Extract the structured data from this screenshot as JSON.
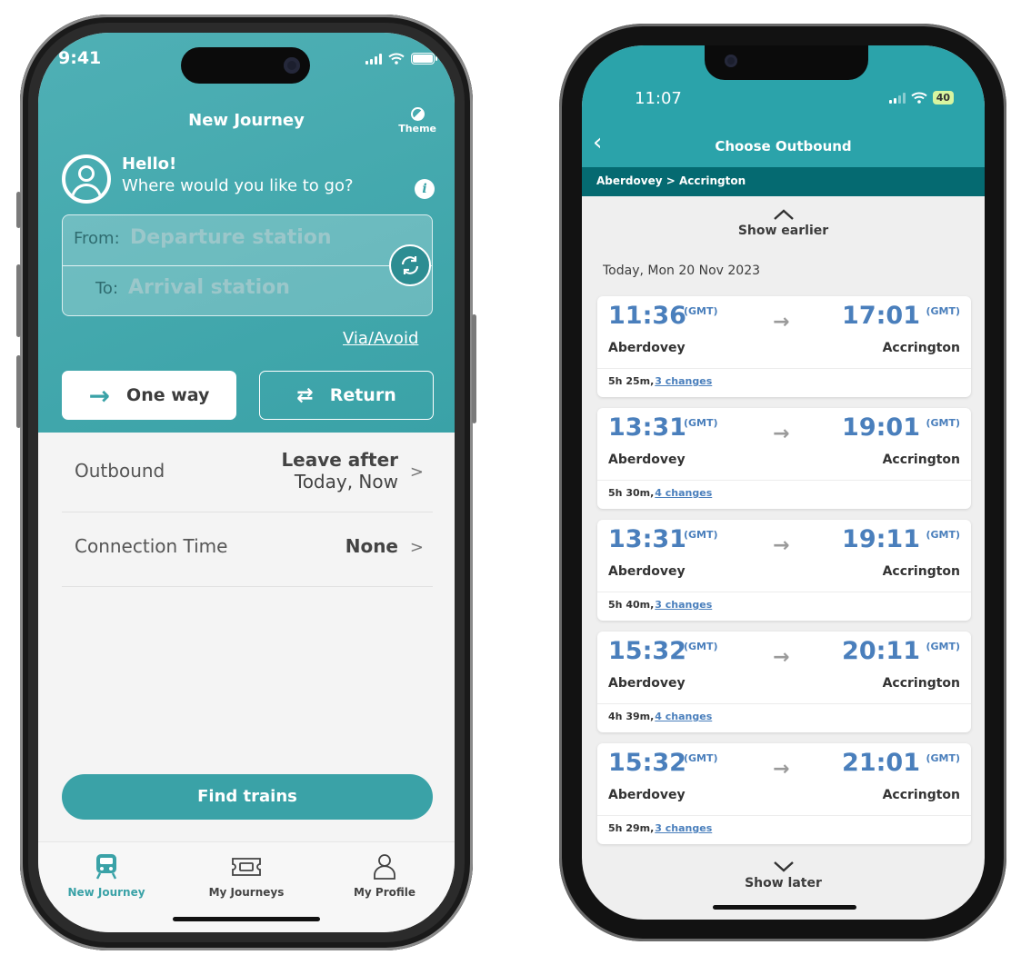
{
  "phone1": {
    "status": {
      "time": "9:41"
    },
    "header": {
      "title": "New Journey",
      "theme_label": "Theme"
    },
    "greeting": {
      "hello": "Hello!",
      "prompt": "Where would you like to go?"
    },
    "stations": {
      "from_label": "From:",
      "from_placeholder": "Departure station",
      "to_label": "To:",
      "to_placeholder": "Arrival station"
    },
    "via_avoid": "Via/Avoid",
    "trip_type": {
      "one_way": "One way",
      "return": "Return",
      "selected": "One way"
    },
    "outbound": {
      "label": "Outbound",
      "value_line1": "Leave after",
      "value_line2": "Today, Now"
    },
    "connection": {
      "label": "Connection Time",
      "value": "None"
    },
    "find_button": "Find trains",
    "tabs": [
      {
        "label": "New Journey",
        "icon": "train-icon",
        "active": true
      },
      {
        "label": "My Journeys",
        "icon": "ticket-icon",
        "active": false
      },
      {
        "label": "My Profile",
        "icon": "profile-icon",
        "active": false
      }
    ]
  },
  "phone2": {
    "status": {
      "time": "11:07",
      "battery": "40"
    },
    "header": {
      "title": "Choose Outbound"
    },
    "route": "Aberdovey > Accrington",
    "show_earlier": "Show earlier",
    "date_header": "Today,  Mon 20 Nov 2023",
    "show_later": "Show later",
    "journeys": [
      {
        "dep_time": "11:36",
        "dep_tz": "(GMT)",
        "arr_time": "17:01",
        "arr_tz": "(GMT)",
        "origin": "Aberdovey",
        "destination": "Accrington",
        "duration": "5h 25m,",
        "changes": "3 changes"
      },
      {
        "dep_time": "13:31",
        "dep_tz": "(GMT)",
        "arr_time": "19:01",
        "arr_tz": "(GMT)",
        "origin": "Aberdovey",
        "destination": "Accrington",
        "duration": "5h 30m,",
        "changes": "4 changes"
      },
      {
        "dep_time": "13:31",
        "dep_tz": "(GMT)",
        "arr_time": "19:11",
        "arr_tz": "(GMT)",
        "origin": "Aberdovey",
        "destination": "Accrington",
        "duration": "5h 40m,",
        "changes": "3 changes"
      },
      {
        "dep_time": "15:32",
        "dep_tz": "(GMT)",
        "arr_time": "20:11",
        "arr_tz": "(GMT)",
        "origin": "Aberdovey",
        "destination": "Accrington",
        "duration": "4h 39m,",
        "changes": "4 changes"
      },
      {
        "dep_time": "15:32",
        "dep_tz": "(GMT)",
        "arr_time": "21:01",
        "arr_tz": "(GMT)",
        "origin": "Aberdovey",
        "destination": "Accrington",
        "duration": "5h 29m,",
        "changes": "3 changes"
      }
    ]
  },
  "colors": {
    "teal": "#3aa2a7",
    "dark_teal": "#056a71",
    "time_blue": "#4a7fbc"
  }
}
